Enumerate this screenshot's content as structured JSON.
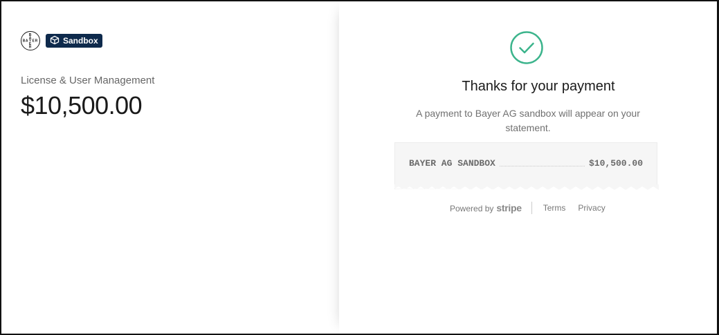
{
  "merchant": {
    "logo_text": "BAYER",
    "badge_label": "Sandbox"
  },
  "order": {
    "product_name": "License & User Management",
    "amount": "$10,500.00"
  },
  "confirmation": {
    "title": "Thanks for your payment",
    "message": "A payment to Bayer AG sandbox will appear on your statement.",
    "receipt_descriptor": "BAYER AG SANDBOX",
    "receipt_amount": "$10,500.00"
  },
  "footer": {
    "powered_by": "Powered by",
    "brand": "stripe",
    "terms": "Terms",
    "privacy": "Privacy"
  },
  "colors": {
    "success": "#3cb48c",
    "badge_bg": "#0e2a4c"
  },
  "icons": {
    "merchant_logo": "bayer-cross-logo",
    "badge": "cube-icon",
    "status": "check-circle-icon"
  }
}
